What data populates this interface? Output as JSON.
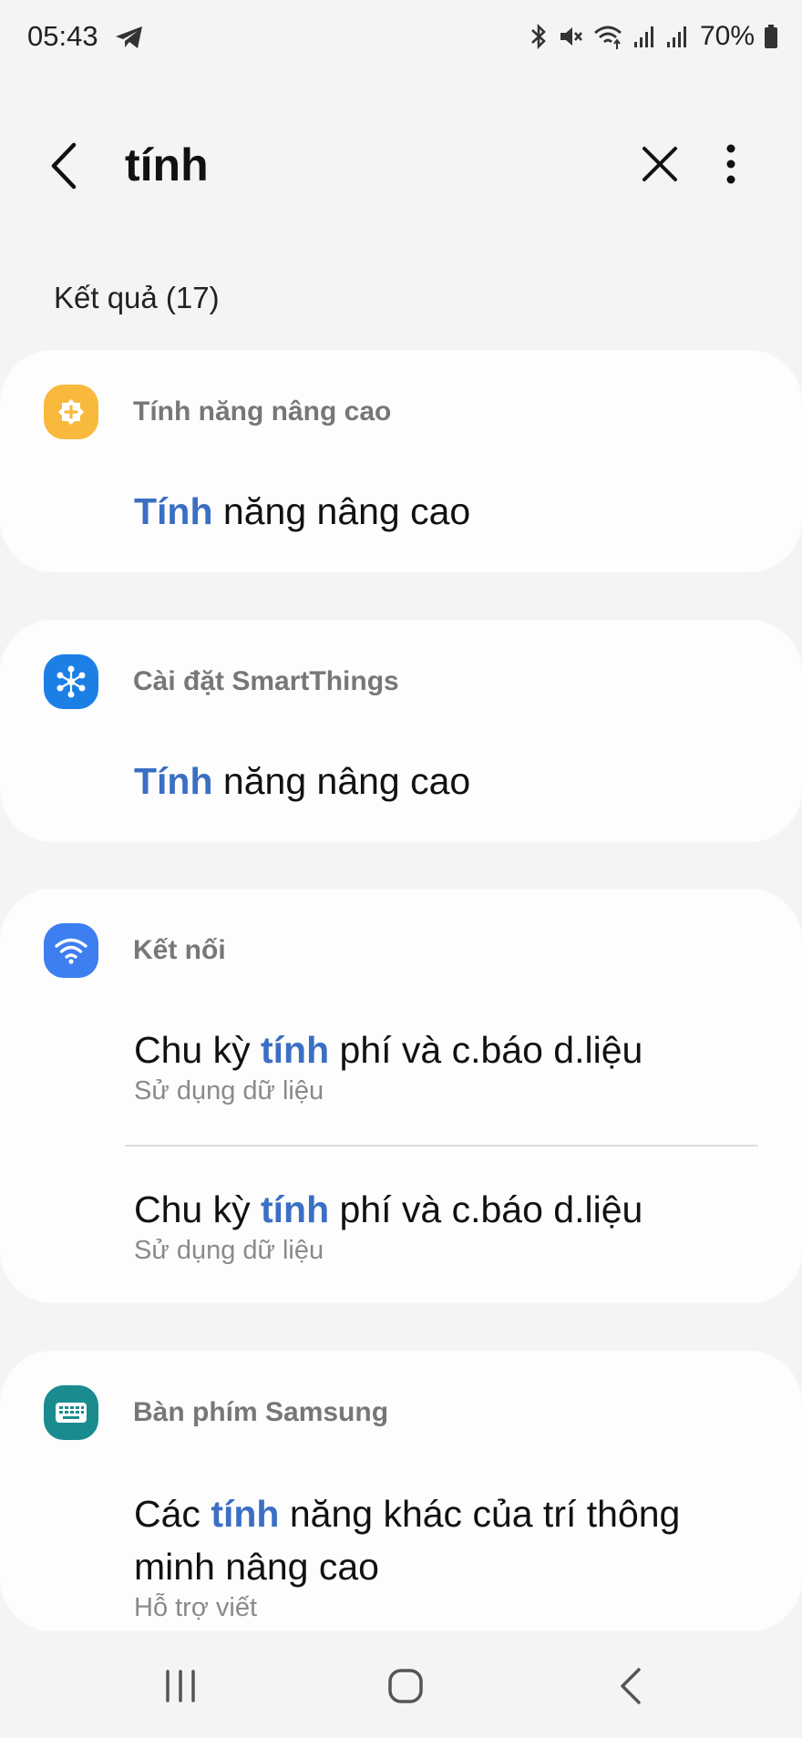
{
  "status_bar": {
    "time": "05:43",
    "battery": "70%"
  },
  "search": {
    "query": "tính"
  },
  "results_header": "Kết quả (17)",
  "groups": [
    {
      "category": "Tính năng nâng cao",
      "icon": "advanced-features-icon",
      "icon_color": "#f8b93d",
      "items": [
        {
          "before": "",
          "highlight": "Tính",
          "after": " năng nâng cao",
          "subtitle": ""
        }
      ]
    },
    {
      "category": "Cài đặt SmartThings",
      "icon": "smartthings-icon",
      "icon_color": "#1b7fe6",
      "items": [
        {
          "before": "",
          "highlight": "Tính",
          "after": " năng nâng cao",
          "subtitle": ""
        }
      ]
    },
    {
      "category": "Kết nối",
      "icon": "wifi-icon",
      "icon_color": "#3d7ef0",
      "items": [
        {
          "before": "Chu kỳ ",
          "highlight": "tính",
          "after": " phí và c.báo d.liệu",
          "subtitle": "Sử dụng dữ liệu"
        },
        {
          "before": "Chu kỳ ",
          "highlight": "tính",
          "after": " phí và c.báo d.liệu",
          "subtitle": "Sử dụng dữ liệu"
        }
      ]
    },
    {
      "category": "Bàn phím Samsung",
      "icon": "keyboard-icon",
      "icon_color": "#1a8c8f",
      "items": [
        {
          "before": "Các ",
          "highlight": "tính",
          "after": " năng khác của trí thông minh nâng cao",
          "subtitle": "Hỗ trợ viết"
        }
      ]
    }
  ],
  "colors": {
    "highlight": "#3b6fc4",
    "background": "#f4f4f4",
    "card": "#fdfdfd"
  }
}
